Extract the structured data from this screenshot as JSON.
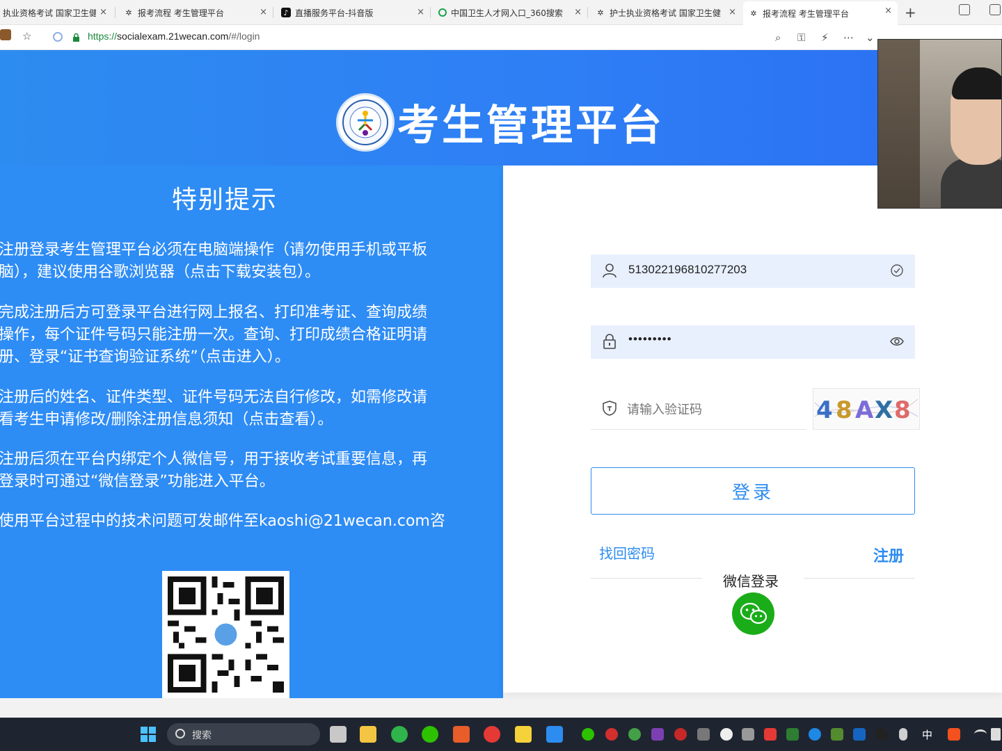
{
  "browser": {
    "tabs": [
      {
        "title": "执业资格考试 国家卫生健"
      },
      {
        "title": "报考流程 考生管理平台"
      },
      {
        "title": "直播服务平台-抖音版"
      },
      {
        "title": "中国卫生人才网入口_360搜索"
      },
      {
        "title": "护士执业资格考试 国家卫生健"
      },
      {
        "title": "报考流程 考生管理平台",
        "active": true
      }
    ],
    "new_tab_symbol": "+",
    "close_symbol": "×",
    "url_scheme": "https://",
    "url_host": "socialexam.21wecan.com",
    "url_path": "/#/login"
  },
  "header": {
    "title": "考生管理平台"
  },
  "notice": {
    "title": "特别提示",
    "items": [
      {
        "text_a": "注册登录考生管理平台必须在电脑端操作（请勿使用手机或平板",
        "text_b": "脑），建议使用",
        "link": "谷歌浏览器（点击下载安装包）",
        "text_c": "。"
      },
      {
        "text_a": "完成注册后方可登录平台进行网上报名、打印准考证、查询成绩",
        "text_b": "操作，每个证件号码只能注册一次。查询、打印成绩合格证明请",
        "text_c": "册、登录",
        "link": "“证书查询验证系统”（点击进入）",
        "text_d": "。"
      },
      {
        "text_a": "注册后的姓名、证件类型、证件号码无法自行修改，如需修改请",
        "text_b": "看",
        "link": "考生申请修改/删除注册信息须知（点击查看）",
        "text_c": "。"
      },
      {
        "text_a": "注册后须在平台内绑定个人微信号，用于接收考试重要信息，再",
        "text_b": "登录时可通过“微信登录”功能进入平台。"
      },
      {
        "text_a": "使用平台过程中的技术问题可发邮件至kaoshi@21wecan.com咨"
      }
    ]
  },
  "login": {
    "username_value": "513022196810277203",
    "password_value": "•••••••••",
    "captcha_placeholder": "请输入验证码",
    "captcha_text": "48AX8",
    "submit_label": "登录",
    "forgot_label": "找回密码",
    "register_label": "注册",
    "wechat_label": "微信登录"
  },
  "taskbar": {
    "search_placeholder": "搜索",
    "ime_label": "中"
  },
  "colors": {
    "primary": "#2d8cf0",
    "notice_bg": "#2e8cf5",
    "wechat_green": "#1aad19",
    "field_bg": "#e8f0fe"
  }
}
